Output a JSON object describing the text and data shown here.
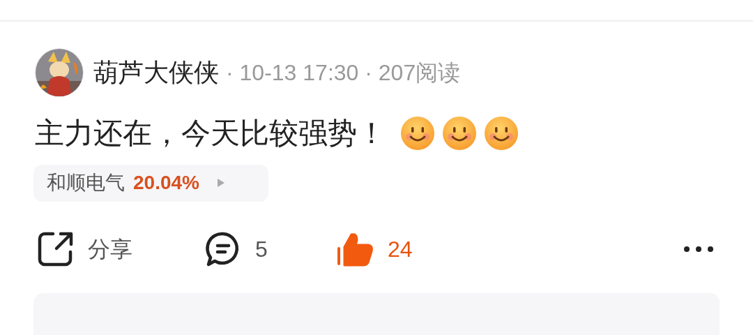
{
  "post": {
    "author": "葫芦大侠侠",
    "meta": "· 10-13 17:30 · 207阅读",
    "text": "主力还在，今天比较强势！",
    "emojis": [
      {
        "kind": "smile"
      },
      {
        "kind": "smile"
      },
      {
        "kind": "smile"
      }
    ],
    "stock": {
      "name": "和顺电气",
      "change": "20.04%"
    },
    "actions": [
      {
        "kind": "share",
        "label": "分享"
      },
      {
        "kind": "comment",
        "label": "5"
      },
      {
        "kind": "like",
        "label": "24",
        "selected": true
      }
    ]
  }
}
